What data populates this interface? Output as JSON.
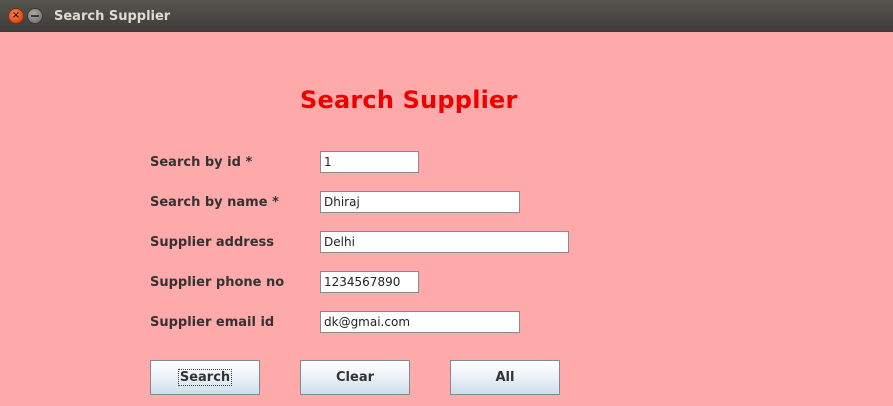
{
  "window": {
    "title": "Search Supplier"
  },
  "form": {
    "heading": "Search Supplier",
    "fields": [
      {
        "label": "Search by id *",
        "value": "1"
      },
      {
        "label": "Search by name *",
        "value": "Dhiraj"
      },
      {
        "label": "Supplier address",
        "value": "Delhi"
      },
      {
        "label": "Supplier phone no",
        "value": "1234567890"
      },
      {
        "label": "Supplier email id",
        "value": "dk@gmai.com"
      }
    ]
  },
  "buttons": {
    "search": "Search",
    "clear": "Clear",
    "all": "All"
  },
  "colors": {
    "background": "#ffaaaa",
    "heading": "#ee0000"
  }
}
